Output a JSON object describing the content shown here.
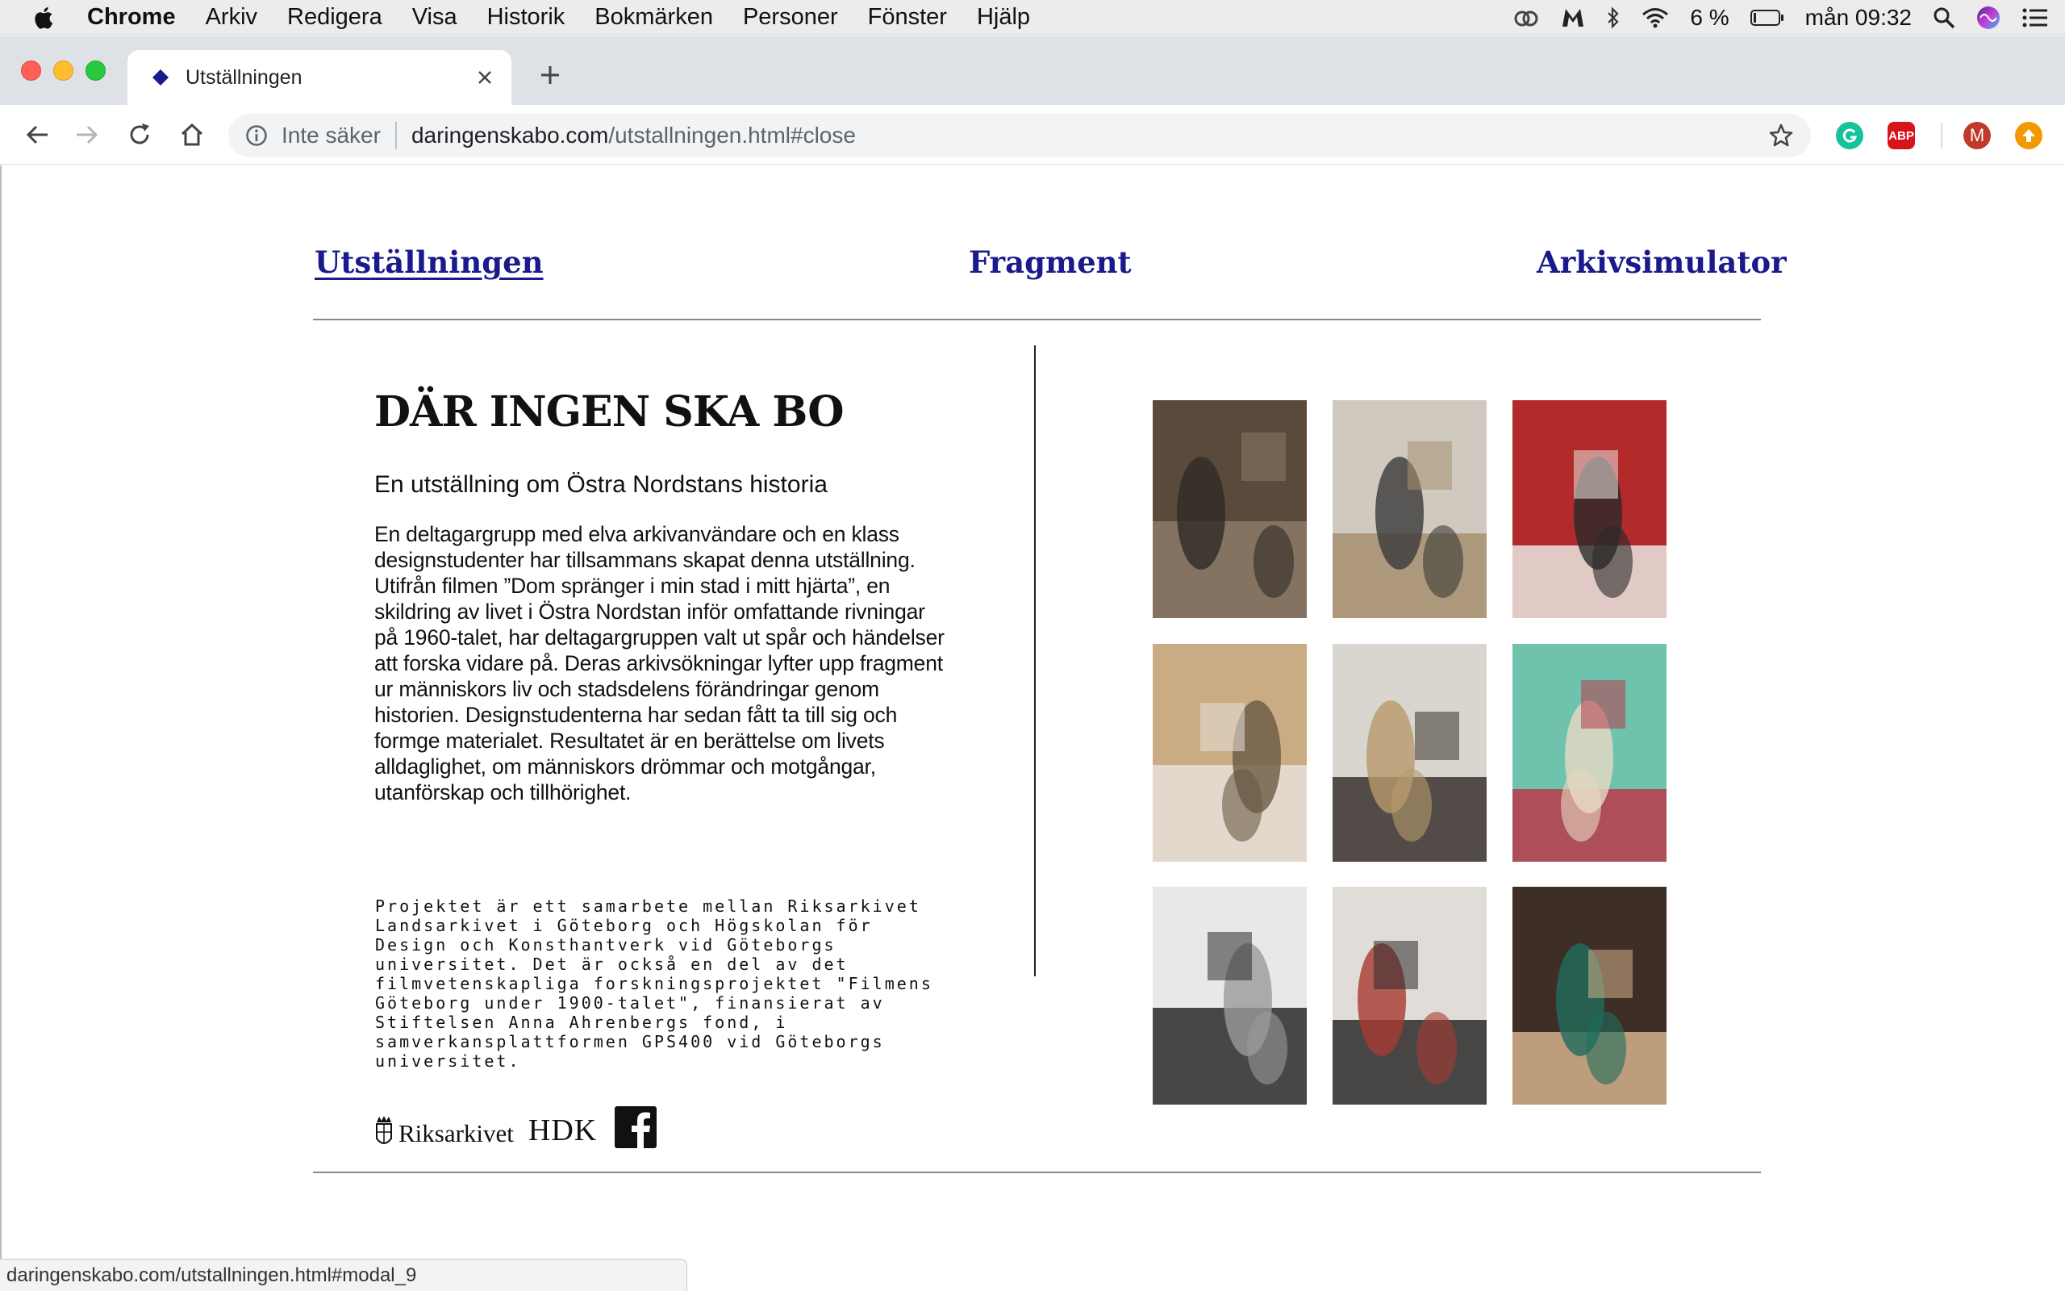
{
  "menubar": {
    "app_name": "Chrome",
    "menus": [
      "Arkiv",
      "Redigera",
      "Visa",
      "Historik",
      "Bokmärken",
      "Personer",
      "Fönster",
      "Hjälp"
    ],
    "battery": "6 %",
    "clock": "mån 09:32",
    "icons": [
      "apple-icon",
      "creative-cloud-icon",
      "m-app-icon",
      "bluetooth-icon",
      "wifi-icon",
      "battery-icon",
      "spotlight-search-icon",
      "siri-icon",
      "notification-center-icon"
    ]
  },
  "browser": {
    "tab_title": "Utställningen",
    "security_label": "Inte säker",
    "url_host": "daringenskabo.com",
    "url_path": "/utstallningen.html#close",
    "status_url": "daringenskabo.com/utstallningen.html#modal_9",
    "extensions": [
      {
        "name": "grammarly",
        "label": "",
        "color": "#15c39a"
      },
      {
        "name": "adblock-plus",
        "label": "ABP",
        "color": "#d7141a"
      },
      {
        "name": "profile",
        "label": "M",
        "color": "#c0392b"
      },
      {
        "name": "update",
        "label": "",
        "color": "#f29900"
      }
    ]
  },
  "nav": {
    "items": [
      "Utställningen",
      "Fragment",
      "Arkivsimulator"
    ]
  },
  "exhibition": {
    "title": "DÄR INGEN SKA BO",
    "subtitle": "En utställning om Östra Nordstans historia",
    "body": "En deltagargrupp med elva arkivanvändare och en klass designstudenter har tillsammans skapat denna utställning. Utifrån filmen ”Dom spränger i min stad i mitt hjärta”, en skildring av livet i Östra Nordstan inför omfattande rivningar på 1960-talet, har deltagargruppen valt ut spår och händelser att forska vidare på. Deras arkivsökningar lyfter upp fragment ur människors liv och stadsdelens förändringar genom historien. Designstudenterna har sedan fått ta till sig och formge materialet. Resultatet är en berättelse om livets alldaglighet, om människors drömmar och motgångar, utanförskap och tillhörighet.",
    "note": "Projektet är ett samarbete mellan Riksarkivet Landsarkivet i Göteborg och Högskolan för Design och Konsthantverk vid Göteborgs universitet. Det är också en del av det filmvetenskapliga forskningsprojektet \"Filmens Göteborg under 1900-talet\", finansierat av Stiftelsen Anna Ahrenbergs fond, i samverkansplattformen GPS400 vid Göteborgs universitet."
  },
  "logos": {
    "riksarkivet": "Riksarkivet",
    "hdk": "HDK"
  },
  "gallery": {
    "images": [
      {
        "name": "photo-archive-basement",
        "colors": [
          "#5a4a3c",
          "#8c7a66",
          "#2e2a26"
        ]
      },
      {
        "name": "photo-exhibition-hall",
        "colors": [
          "#cfc9c0",
          "#a88f70",
          "#3b3b3b"
        ]
      },
      {
        "name": "photo-person-drawing",
        "colors": [
          "#b22a2a",
          "#e9e6e0",
          "#2a2a2a"
        ]
      },
      {
        "name": "photo-cardboard-models",
        "colors": [
          "#c9ab84",
          "#e6e1d8",
          "#6b5a44"
        ]
      },
      {
        "name": "photo-students-meeting",
        "colors": [
          "#d9d6cf",
          "#3a3330",
          "#b89a6d"
        ]
      },
      {
        "name": "photo-poster-wall",
        "colors": [
          "#6fc3ad",
          "#b8394a",
          "#e7d9c2"
        ]
      },
      {
        "name": "photo-screening-room",
        "colors": [
          "#e8e8e6",
          "#2a2a2a",
          "#9a9a9a"
        ]
      },
      {
        "name": "photo-camera-setup",
        "colors": [
          "#e0ddd8",
          "#2b2b2b",
          "#a83a32"
        ]
      },
      {
        "name": "photo-workshop-table",
        "colors": [
          "#3d2e26",
          "#d3b08c",
          "#1f6d5c"
        ]
      }
    ]
  }
}
